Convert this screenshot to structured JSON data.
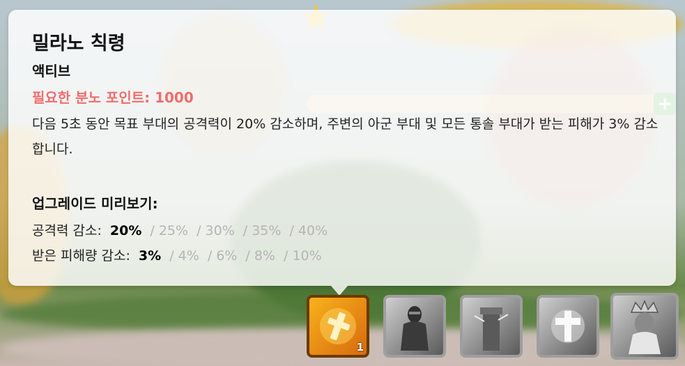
{
  "skill_tooltip": {
    "title": "밀라노 칙령",
    "type": "액티브",
    "rage_cost": "필요한 분노 포인트: 1000",
    "description": "다음 5초 동안 목표 부대의 공격력이 20% 감소하며, 주변의 아군 부대 및 모든 통솔 부대가 받는 피해가 3% 감소합니다.",
    "upgrade_preview_title": "업그레이드 미리보기:",
    "upgrade_rows": [
      {
        "label": "공격력 감소:",
        "current": "20%",
        "levels": [
          "25%",
          "30%",
          "35%",
          "40%"
        ]
      },
      {
        "label": "받은 피해량 감소:",
        "current": "3%",
        "levels": [
          "4%",
          "6%",
          "8%",
          "10%"
        ]
      }
    ]
  },
  "skill_bar": {
    "skills": [
      {
        "icon": "cross-icon",
        "level": "1",
        "state": "active"
      },
      {
        "icon": "knight-icon",
        "state": "locked"
      },
      {
        "icon": "tower-icon",
        "state": "locked"
      },
      {
        "icon": "holy-cross-icon",
        "state": "locked"
      },
      {
        "icon": "crowned-king-icon",
        "state": "locked"
      }
    ]
  },
  "colors": {
    "rage_text": "#f06e6e",
    "upgrade_inactive_text": "#b4b4b4",
    "active_skill_bg": "#f7b21b"
  }
}
